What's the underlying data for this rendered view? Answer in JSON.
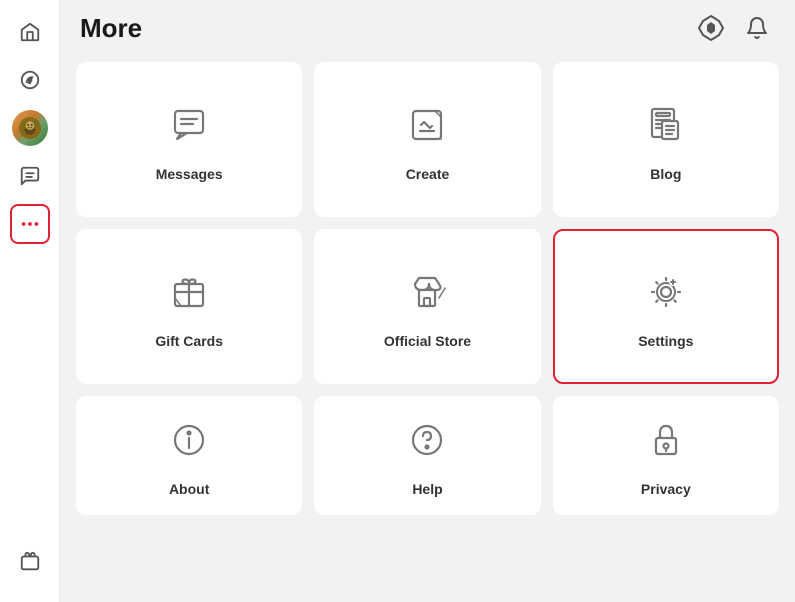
{
  "header": {
    "title": "More",
    "icons": {
      "robux": "robux-icon",
      "notification": "notification-icon"
    }
  },
  "sidebar": {
    "items": [
      {
        "name": "home",
        "label": "Home",
        "active": false
      },
      {
        "name": "discover",
        "label": "Discover",
        "active": false
      },
      {
        "name": "avatar",
        "label": "Avatar",
        "active": false
      },
      {
        "name": "chat",
        "label": "Chat",
        "active": false
      },
      {
        "name": "more",
        "label": "More",
        "active": true
      }
    ],
    "bottom_items": [
      {
        "name": "robux-sidebar",
        "label": "Robux"
      }
    ]
  },
  "grid": {
    "cards": [
      {
        "id": "messages",
        "label": "Messages",
        "icon": "messages",
        "selected": false
      },
      {
        "id": "create",
        "label": "Create",
        "icon": "create",
        "selected": false
      },
      {
        "id": "blog",
        "label": "Blog",
        "icon": "blog",
        "selected": false
      },
      {
        "id": "gift-cards",
        "label": "Gift Cards",
        "icon": "gift-cards",
        "selected": false
      },
      {
        "id": "official-store",
        "label": "Official Store",
        "icon": "official-store",
        "selected": false
      },
      {
        "id": "settings",
        "label": "Settings",
        "icon": "settings",
        "selected": true
      },
      {
        "id": "about",
        "label": "About",
        "icon": "about",
        "selected": false
      },
      {
        "id": "help",
        "label": "Help",
        "icon": "help",
        "selected": false
      },
      {
        "id": "privacy",
        "label": "Privacy",
        "icon": "privacy",
        "selected": false
      }
    ]
  }
}
